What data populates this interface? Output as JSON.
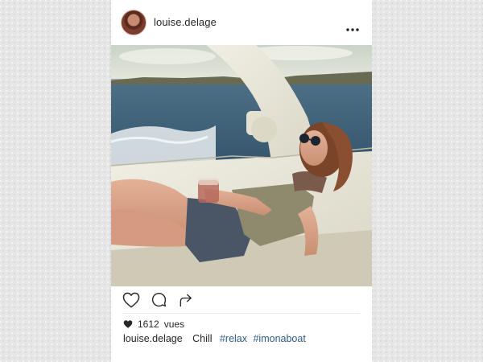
{
  "post": {
    "username": "louise.delage",
    "views_count": "1612",
    "views_label": "vues",
    "caption_user": "louise.delage",
    "caption_text": "Chill",
    "hashtags": [
      "#relax",
      "#imonaboat"
    ]
  },
  "icons": {
    "more": "more-horizontal-icon",
    "like": "heart-outline-icon",
    "comment": "comment-bubble-icon",
    "share": "share-arrow-icon",
    "views": "heart-filled-icon"
  },
  "colors": {
    "background": "#e6e6e6",
    "card": "#ffffff",
    "text": "#262626",
    "hashtag": "#2f5b86"
  }
}
